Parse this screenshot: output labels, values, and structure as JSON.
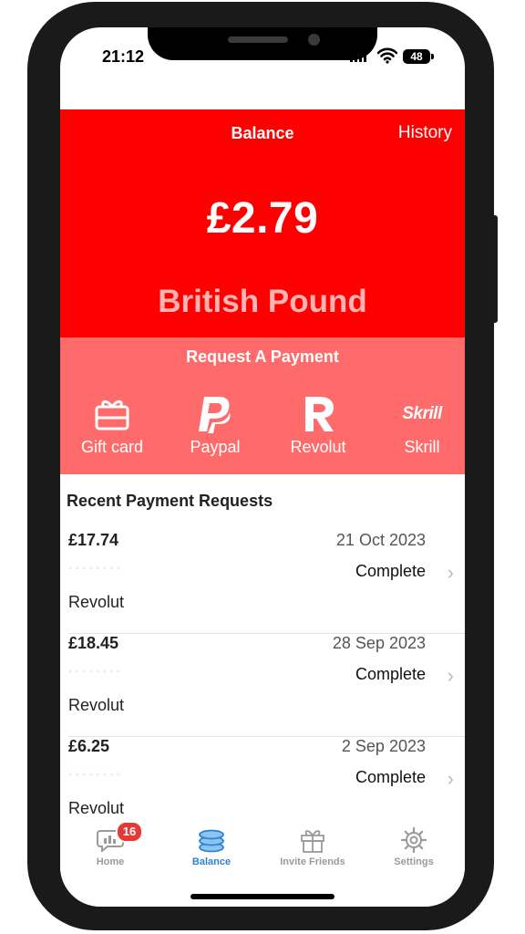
{
  "status_bar": {
    "time": "21:12",
    "battery": "48"
  },
  "header": {
    "title": "Balance",
    "history_link": "History"
  },
  "balance": {
    "amount": "£2.79",
    "currency": "British Pound"
  },
  "request_payment": {
    "title": "Request A Payment",
    "methods": [
      {
        "label": "Gift card",
        "icon": "gift-card-icon"
      },
      {
        "label": "Paypal",
        "icon": "paypal-icon"
      },
      {
        "label": "Revolut",
        "icon": "revolut-icon"
      },
      {
        "label": "Skrill",
        "icon": "skrill-icon",
        "logo_text": "Skrill"
      }
    ]
  },
  "recent": {
    "title": "Recent Payment Requests",
    "rows": [
      {
        "amount": "£17.74",
        "date": "21 Oct 2023",
        "status": "Complete",
        "method": "Revolut"
      },
      {
        "amount": "£18.45",
        "date": "28 Sep 2023",
        "status": "Complete",
        "method": "Revolut"
      },
      {
        "amount": "£6.25",
        "date": "2 Sep 2023",
        "status": "Complete",
        "method": "Revolut"
      }
    ]
  },
  "tabbar": {
    "items": [
      {
        "label": "Home",
        "icon": "chat-chart-icon",
        "badge": "16"
      },
      {
        "label": "Balance",
        "icon": "coins-icon",
        "active": true
      },
      {
        "label": "Invite Friends",
        "icon": "gift-icon"
      },
      {
        "label": "Settings",
        "icon": "gear-icon"
      }
    ]
  },
  "colors": {
    "hero": "#ff0000",
    "request_panel": "#ff6b6b",
    "active_tab": "#2f80d0",
    "badge": "#e53935"
  }
}
